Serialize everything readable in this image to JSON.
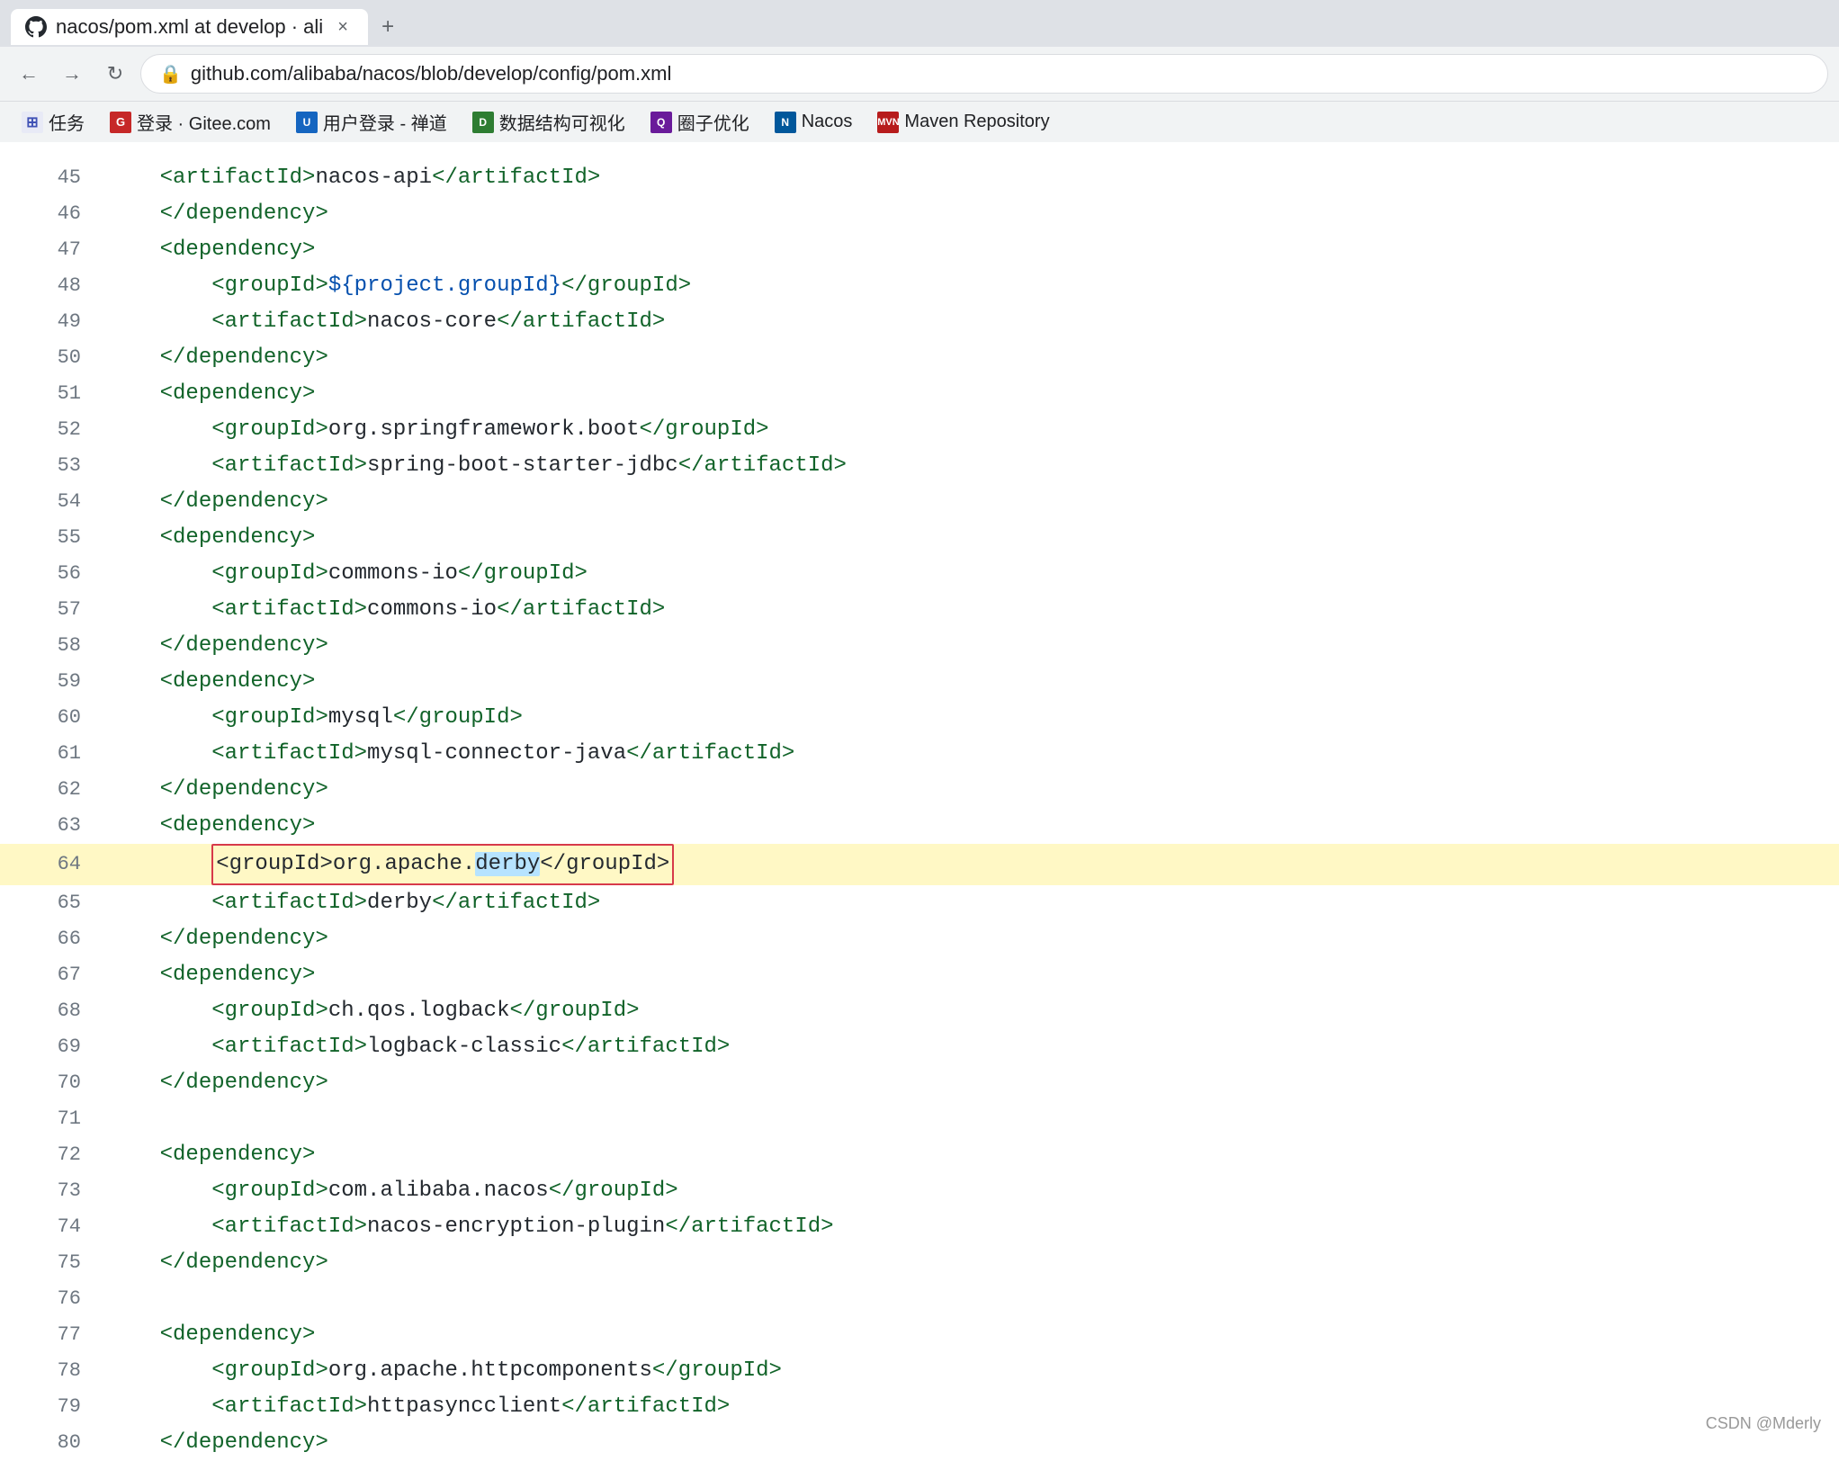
{
  "browser": {
    "tab": {
      "title": "nacos/pom.xml at develop · ali",
      "favicon": "GH",
      "close_label": "×",
      "new_tab_label": "+"
    },
    "address": "github.com/alibaba/nacos/blob/develop/config/pom.xml",
    "nav": {
      "back": "←",
      "forward": "→",
      "reload": "↻"
    },
    "bookmarks": [
      {
        "id": "apps",
        "icon": "⋮⋮",
        "label": "任务",
        "bg": "#e8eaf6",
        "color": "#3f51b5"
      },
      {
        "id": "gitee",
        "icon": "G",
        "label": "登录 · Gitee.com",
        "bg": "#c62828",
        "color": "#fff"
      },
      {
        "id": "user",
        "icon": "U",
        "label": "用户登录 - 禅道",
        "bg": "#1565c0",
        "color": "#fff"
      },
      {
        "id": "data",
        "icon": "D",
        "label": "数据结构可视化",
        "bg": "#2e7d32",
        "color": "#fff"
      },
      {
        "id": "qz",
        "icon": "Q",
        "label": "圈子优化",
        "bg": "#6a1b9a",
        "color": "#fff"
      },
      {
        "id": "nacos",
        "icon": "N",
        "label": "Nacos",
        "bg": "#01579b",
        "color": "#fff"
      },
      {
        "id": "maven",
        "icon": "M",
        "label": "Maven Repository",
        "bg": "#b71c1c",
        "color": "#fff"
      }
    ]
  },
  "code": {
    "lines": [
      {
        "num": 45,
        "content": "    <artifactId>nacos-api</artifactId>"
      },
      {
        "num": 46,
        "content": "    </dependency>"
      },
      {
        "num": 47,
        "content": "    <dependency>"
      },
      {
        "num": 48,
        "content": "        <groupId>${project.groupId}</groupId>"
      },
      {
        "num": 49,
        "content": "        <artifactId>nacos-core</artifactId>"
      },
      {
        "num": 50,
        "content": "    </dependency>"
      },
      {
        "num": 51,
        "content": "    <dependency>"
      },
      {
        "num": 52,
        "content": "        <groupId>org.springframework.boot</groupId>"
      },
      {
        "num": 53,
        "content": "        <artifactId>spring-boot-starter-jdbc</artifactId>"
      },
      {
        "num": 54,
        "content": "    </dependency>"
      },
      {
        "num": 55,
        "content": "    <dependency>"
      },
      {
        "num": 56,
        "content": "        <groupId>commons-io</groupId>"
      },
      {
        "num": 57,
        "content": "        <artifactId>commons-io</artifactId>"
      },
      {
        "num": 58,
        "content": "    </dependency>"
      },
      {
        "num": 59,
        "content": "    <dependency>"
      },
      {
        "num": 60,
        "content": "        <groupId>mysql</groupId>"
      },
      {
        "num": 61,
        "content": "        <artifactId>mysql-connector-java</artifactId>"
      },
      {
        "num": 62,
        "content": "    </dependency>"
      },
      {
        "num": 63,
        "content": "    <dependency>"
      },
      {
        "num": 64,
        "content": "        <groupId>org.apache.derby</groupId>",
        "highlighted": true,
        "redbox": true,
        "selected": "derby"
      },
      {
        "num": 65,
        "content": "        <artifactId>derby</artifactId>"
      },
      {
        "num": 66,
        "content": "    </dependency>"
      },
      {
        "num": 67,
        "content": "    <dependency>"
      },
      {
        "num": 68,
        "content": "        <groupId>ch.qos.logback</groupId>"
      },
      {
        "num": 69,
        "content": "        <artifactId>logback-classic</artifactId>"
      },
      {
        "num": 70,
        "content": "    </dependency>"
      },
      {
        "num": 71,
        "content": ""
      },
      {
        "num": 72,
        "content": "    <dependency>"
      },
      {
        "num": 73,
        "content": "        <groupId>com.alibaba.nacos</groupId>"
      },
      {
        "num": 74,
        "content": "        <artifactId>nacos-encryption-plugin</artifactId>"
      },
      {
        "num": 75,
        "content": "    </dependency>"
      },
      {
        "num": 76,
        "content": ""
      },
      {
        "num": 77,
        "content": "    <dependency>"
      },
      {
        "num": 78,
        "content": "        <groupId>org.apache.httpcomponents</groupId>"
      },
      {
        "num": 79,
        "content": "        <artifactId>httpasyncclient</artifactId>"
      },
      {
        "num": 80,
        "content": "    </dependency>"
      }
    ]
  },
  "watermark": "CSDN @Mderly"
}
